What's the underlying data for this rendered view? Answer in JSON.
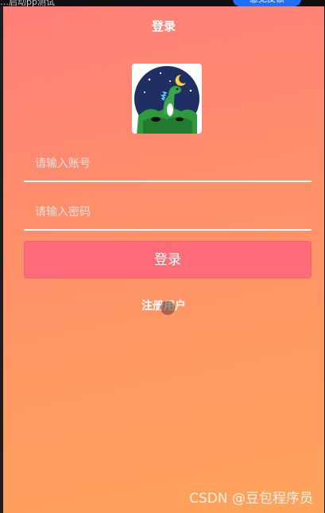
{
  "browser_bar": {
    "crumb": "…启动pp测试",
    "feedback_label": "意见反馈"
  },
  "nav": {
    "title": "登录"
  },
  "logo": {
    "icon": "dinosaur-moon-night-icon"
  },
  "form": {
    "account_placeholder": "请输入账号",
    "account_value": "",
    "password_placeholder": "请输入密码",
    "password_value": "",
    "login_label": "登录",
    "register_label": "注册用户"
  },
  "watermark": "CSDN @豆包程序员",
  "colors": {
    "gradient_top": "#ff7f7a",
    "gradient_bottom": "#ffa35a",
    "login_button": "#ff6b78"
  }
}
